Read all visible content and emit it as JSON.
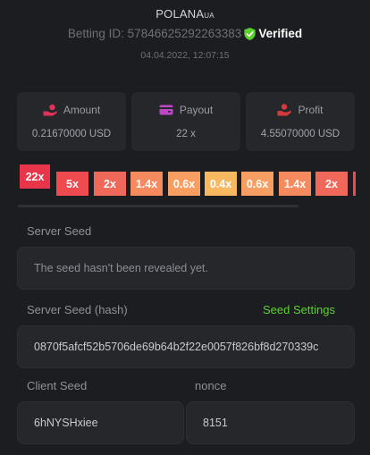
{
  "header": {
    "user_name": "POLANA",
    "user_suffix": "UA",
    "betting_id": "Betting ID: 57846625292263383",
    "verified_label": "Verified",
    "timestamp": "04.04.2022, 12:07:15"
  },
  "stats": {
    "amount": {
      "label": "Amount",
      "value": "0.21670000 USD"
    },
    "payout": {
      "label": "Payout",
      "value": "22 x"
    },
    "profit": {
      "label": "Profit",
      "value": "4.55070000 USD"
    }
  },
  "multipliers": [
    "22x",
    "5x",
    "2x",
    "1.4x",
    "0.6x",
    "0.4x",
    "0.6x",
    "1.4x",
    "2x"
  ],
  "selected_multiplier_index": 0,
  "colors": {
    "accent_green": "#5bd12e",
    "amount_icon": "#e0335a",
    "payout_icon": "#c046c8",
    "profit_icon": "#d53a3a"
  },
  "server_seed": {
    "label": "Server Seed",
    "value": "The seed hasn't been revealed yet."
  },
  "server_seed_hash": {
    "label": "Server Seed (hash)",
    "settings_link": "Seed Settings",
    "value": "0870f5afcf52b5706de69b64b2f22e0057f826bf8d270339c"
  },
  "client_seed": {
    "label": "Client Seed",
    "value": "6hNYSHxiee"
  },
  "nonce": {
    "label": "nonce",
    "value": "8151"
  }
}
